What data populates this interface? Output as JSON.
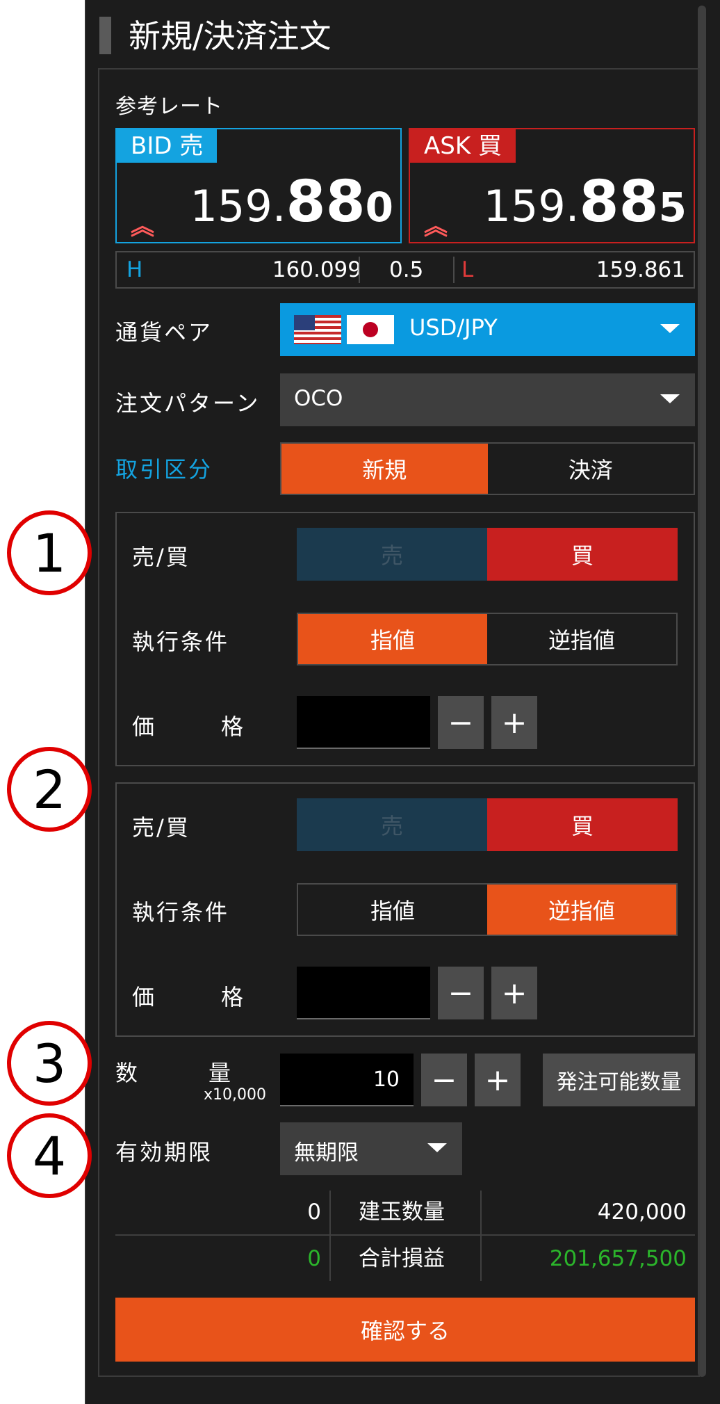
{
  "header": {
    "title": "新規/決済注文"
  },
  "rates": {
    "label": "参考レート",
    "bid": {
      "tag": "BID 売",
      "int": "159.",
      "big": "88",
      "small": "0",
      "trend_icon": "double-chevron-up"
    },
    "ask": {
      "tag": "ASK 買",
      "int": "159.",
      "big": "88",
      "small": "5",
      "trend_icon": "double-chevron-up"
    },
    "high_label": "H",
    "high": "160.099",
    "spread": "0.5",
    "low_label": "L",
    "low": "159.861"
  },
  "currency": {
    "label": "通貨ペア",
    "value": "USD/JPY",
    "flags": [
      "us-flag",
      "jp-flag"
    ]
  },
  "pattern": {
    "label": "注文パターン",
    "value": "OCO"
  },
  "trade_type": {
    "label": "取引区分",
    "options": [
      "新規",
      "決済"
    ],
    "selected": "新規"
  },
  "order1": {
    "side_label": "売/買",
    "side_options": [
      "売",
      "買"
    ],
    "side_selected": "買",
    "cond_label": "執行条件",
    "cond_options": [
      "指値",
      "逆指値"
    ],
    "cond_selected": "指値",
    "price_label_1": "価",
    "price_label_2": "格",
    "price_value": "",
    "minus": "−",
    "plus": "+"
  },
  "order2": {
    "side_label": "売/買",
    "side_options": [
      "売",
      "買"
    ],
    "side_selected": "買",
    "cond_label": "執行条件",
    "cond_options": [
      "指値",
      "逆指値"
    ],
    "cond_selected": "逆指値",
    "price_label_1": "価",
    "price_label_2": "格",
    "price_value": "",
    "minus": "−",
    "plus": "+"
  },
  "quantity": {
    "label_1": "数",
    "label_2": "量",
    "unit": "x10,000",
    "value": "10",
    "minus": "−",
    "plus": "+",
    "available_button": "発注可能数量"
  },
  "expiry": {
    "label": "有効期限",
    "value": "無期限"
  },
  "summary": {
    "rows": [
      {
        "left": "0",
        "label": "建玉数量",
        "right": "420,000",
        "color": "#ffffff"
      },
      {
        "left": "0",
        "label": "合計損益",
        "right": "201,657,500",
        "color": "#2bb52b"
      }
    ]
  },
  "confirm_button": "確認する",
  "annotations": [
    "1",
    "2",
    "3",
    "4"
  ],
  "colors": {
    "accent_orange": "#e8531a",
    "bid_blue": "#14a3e0",
    "ask_red": "#c8201f",
    "buy_red": "#c8201f",
    "sell_dark": "#1b3a4e",
    "profit_green": "#2bb52b"
  }
}
